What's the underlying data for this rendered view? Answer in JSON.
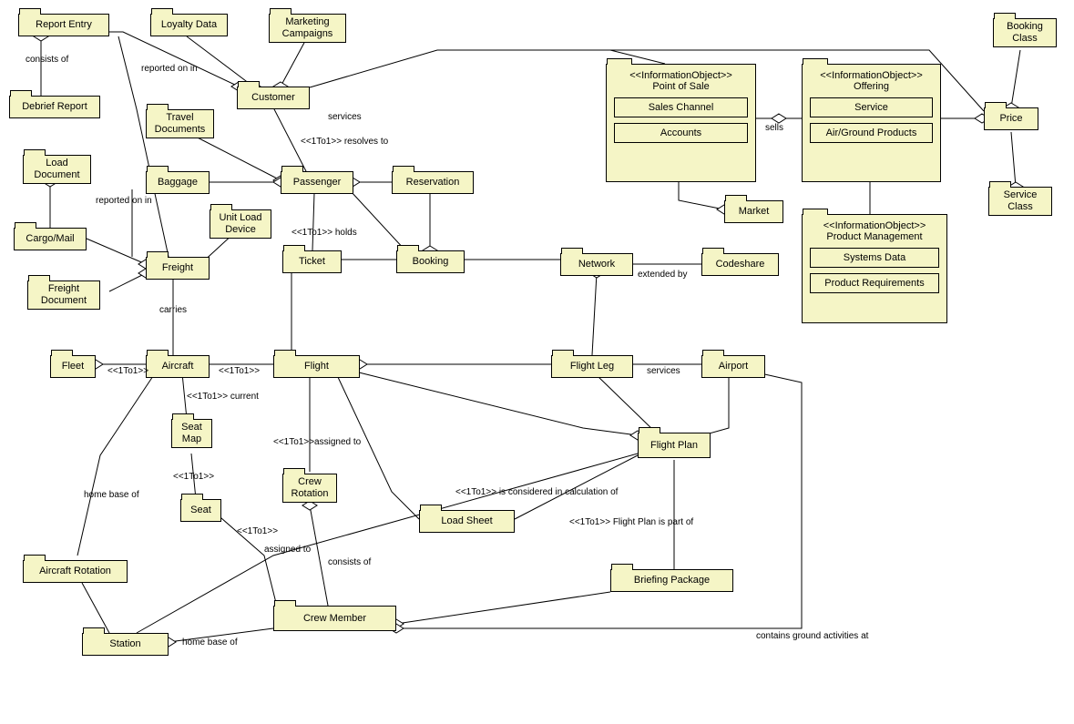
{
  "nodes": {
    "reportEntry": "Report Entry",
    "loyaltyData": "Loyalty Data",
    "marketingCampaigns": "Marketing\nCampaigns",
    "bookingClass": "Booking\nClass",
    "debriefReport": "Debrief Report",
    "travelDocuments": "Travel\nDocuments",
    "customer": "Customer",
    "price": "Price",
    "loadDocument": "Load\nDocument",
    "baggage": "Baggage",
    "passenger": "Passenger",
    "reservation": "Reservation",
    "serviceClass": "Service\nClass",
    "cargoMail": "Cargo/Mail",
    "unitLoadDevice": "Unit Load\nDevice",
    "market": "Market",
    "freight": "Freight",
    "ticket": "Ticket",
    "booking": "Booking",
    "network": "Network",
    "codeshare": "Codeshare",
    "freightDocument": "Freight\nDocument",
    "fleet": "Fleet",
    "aircraft": "Aircraft",
    "flight": "Flight",
    "flightLeg": "Flight Leg",
    "airport": "Airport",
    "seatMap": "Seat\nMap",
    "crewRotation": "Crew\nRotation",
    "flightPlan": "Flight Plan",
    "seat": "Seat",
    "loadSheet": "Load Sheet",
    "aircraftRotation": "Aircraft Rotation",
    "briefingPackage": "Briefing Package",
    "crewMember": "Crew Member",
    "station": "Station"
  },
  "packages": {
    "pointOfSale": {
      "stereo": "<<InformationObject>>",
      "title": "Point of Sale",
      "items": [
        "Sales Channel",
        "Accounts"
      ]
    },
    "offering": {
      "stereo": "<<InformationObject>>",
      "title": "Offering",
      "items": [
        "Service",
        "Air/Ground Products"
      ]
    },
    "productMgmt": {
      "stereo": "<<InformationObject>>",
      "title": "Product Management",
      "items": [
        "Systems Data",
        "Product Requirements"
      ]
    }
  },
  "labels": {
    "consistsOf1": "consists of",
    "reportedOnIn1": "reported on in",
    "services1": "services",
    "sells": "sells",
    "resolvesTo": "<<1To1>> resolves to",
    "reportedOnIn2": "reported on in",
    "holds": "<<1To1>> holds",
    "extendedBy": "extended by",
    "carries": "carries",
    "oneToOne1": "<<1To1>>",
    "oneToOne2": "<<1To1>>",
    "current": "<<1To1>> current",
    "services2": "services",
    "assignedTo1": "<<1To1>>assigned to",
    "oneToOne3": "<<1To1>>",
    "homeBaseOf1": "home base of",
    "isConsidered": "<<1To1>> is considered in calculation of",
    "oneToOne4": "<<1To1>>",
    "assignedTo2": "assigned to",
    "consistsOf2": "consists of",
    "flightPlanPartOf": "<<1To1>> Flight Plan is part of",
    "homeBaseOf2": "home base of",
    "containsGround": "contains ground activities at"
  }
}
